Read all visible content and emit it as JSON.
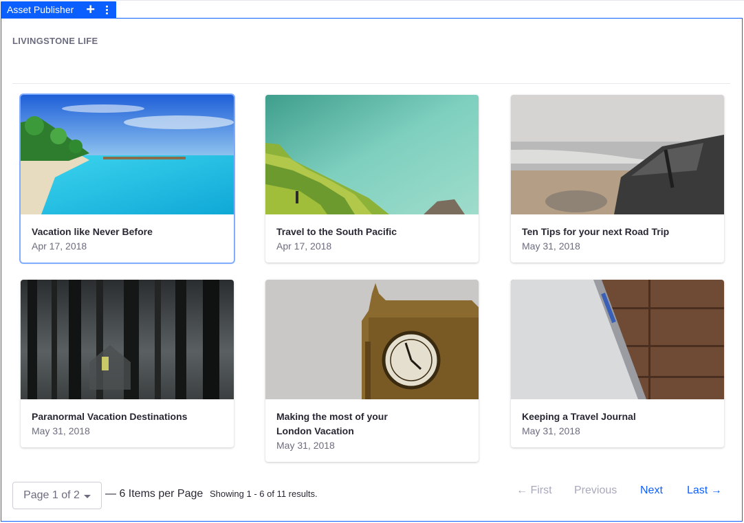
{
  "portlet": {
    "title": "Asset Publisher",
    "add_icon": "plus-icon",
    "options_icon": "vertical-ellipsis-icon",
    "accent_color": "#0b5fff"
  },
  "section": {
    "title": "LIVINGSTONE LIFE"
  },
  "cards": [
    {
      "title": "Vacation like Never Before",
      "date": "Apr 17, 2018",
      "image": "tropical-beach-image"
    },
    {
      "title": "Travel to the South Pacific",
      "date": "Apr 17, 2018",
      "image": "rice-terraces-image"
    },
    {
      "title": "Ten Tips for your next Road Trip",
      "date": "May 31, 2018",
      "image": "car-on-beach-image"
    },
    {
      "title": "Paranormal Vacation Destinations",
      "date": "May 31, 2018",
      "image": "dark-forest-cabin-image"
    },
    {
      "title_line1": "Making the most of your",
      "title_line2": "London Vacation",
      "date": "May 31, 2018",
      "image": "big-ben-clock-image"
    },
    {
      "title": "Keeping a Travel Journal",
      "date": "May 31, 2018",
      "image": "notebook-on-wood-image"
    }
  ],
  "pagination": {
    "page_label": "Page 1 of 2",
    "per_page": "— 6 Items per Page",
    "results": "Showing 1 - 6 of 11 results.",
    "first": "← First",
    "previous": "Previous",
    "next": "Next",
    "last": "Last →"
  }
}
